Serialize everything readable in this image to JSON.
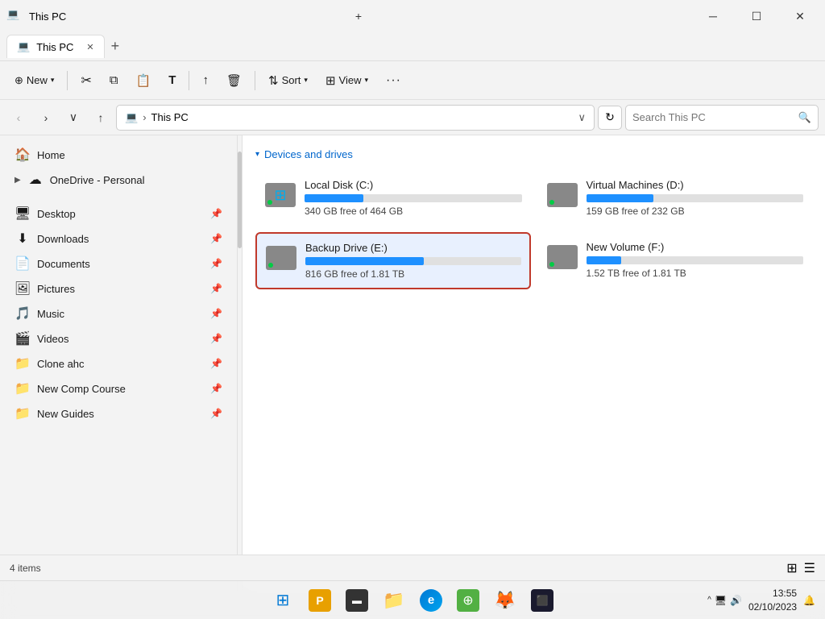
{
  "titleBar": {
    "icon": "💻",
    "title": "This PC",
    "closeLabel": "✕",
    "minimizeLabel": "─",
    "maximizeLabel": "☐",
    "tabLabel": "This PC",
    "tabAddLabel": "+"
  },
  "toolbar": {
    "newLabel": "New",
    "newIcon": "⊕",
    "cutIcon": "✂",
    "copyIcon": "⧉",
    "pasteIcon": "📋",
    "renameIcon": "T",
    "shareIcon": "↑",
    "deleteIcon": "🗑",
    "sortLabel": "Sort",
    "sortIcon": "⇅",
    "viewLabel": "View",
    "viewIcon": "⊞",
    "moreIcon": "···"
  },
  "addressBar": {
    "backLabel": "‹",
    "forwardLabel": "›",
    "downLabel": "∨",
    "upLabel": "↑",
    "addressIcon": "💻",
    "addressText": "This PC",
    "refreshLabel": "↻",
    "searchPlaceholder": "Search This PC"
  },
  "sidebar": {
    "items": [
      {
        "id": "home",
        "icon": "🏠",
        "label": "Home",
        "pinned": false,
        "expandable": false
      },
      {
        "id": "onedrive",
        "icon": "☁",
        "label": "OneDrive - Personal",
        "pinned": false,
        "expandable": true
      },
      {
        "id": "desktop",
        "icon": "🖥",
        "label": "Desktop",
        "pinned": true
      },
      {
        "id": "downloads",
        "icon": "⬇",
        "label": "Downloads",
        "pinned": true
      },
      {
        "id": "documents",
        "icon": "📄",
        "label": "Documents",
        "pinned": true
      },
      {
        "id": "pictures",
        "icon": "🖼",
        "label": "Pictures",
        "pinned": true
      },
      {
        "id": "music",
        "icon": "🎵",
        "label": "Music",
        "pinned": true
      },
      {
        "id": "videos",
        "icon": "🎬",
        "label": "Videos",
        "pinned": true
      },
      {
        "id": "clone-ahc",
        "icon": "📁",
        "label": "Clone ahc",
        "pinned": true
      },
      {
        "id": "new-comp-course",
        "icon": "📁",
        "label": "New Comp Course",
        "pinned": true
      },
      {
        "id": "new-guides",
        "icon": "📁",
        "label": "New Guides",
        "pinned": true
      }
    ]
  },
  "content": {
    "sectionTitle": "Devices and drives",
    "drives": [
      {
        "id": "local-c",
        "name": "Local Disk (C:)",
        "icon": "windows",
        "freeSpace": "340 GB free of 464 GB",
        "usedPercent": 27,
        "selected": false
      },
      {
        "id": "virtual-d",
        "name": "Virtual Machines (D:)",
        "icon": "hdd",
        "freeSpace": "159 GB free of 232 GB",
        "usedPercent": 31,
        "selected": false
      },
      {
        "id": "backup-e",
        "name": "Backup Drive (E:)",
        "icon": "hdd",
        "freeSpace": "816 GB free of 1.81 TB",
        "usedPercent": 55,
        "selected": true
      },
      {
        "id": "new-f",
        "name": "New Volume (F:)",
        "icon": "hdd",
        "freeSpace": "1.52 TB free of 1.81 TB",
        "usedPercent": 16,
        "selected": false
      }
    ]
  },
  "statusBar": {
    "itemCount": "4 items",
    "viewGrid": "⊞",
    "viewList": "☰"
  },
  "taskbar": {
    "icons": [
      {
        "id": "start",
        "symbol": "⊞",
        "color": "#0078d4"
      },
      {
        "id": "pro",
        "symbol": "P",
        "color": "#e8a000"
      },
      {
        "id": "terminal",
        "symbol": "▬",
        "color": "#333"
      },
      {
        "id": "explorer",
        "symbol": "📁",
        "color": "#f0a500"
      },
      {
        "id": "edge",
        "symbol": "e",
        "color": "#0078d4"
      },
      {
        "id": "xbox",
        "symbol": "⊕",
        "color": "#52b043"
      },
      {
        "id": "firefox",
        "symbol": "🦊",
        "color": "#ff6611"
      },
      {
        "id": "cmd",
        "symbol": "⬛",
        "color": "#333"
      }
    ],
    "time": "13:55",
    "date": "02/10/2023",
    "notifIcon": "🔔"
  }
}
